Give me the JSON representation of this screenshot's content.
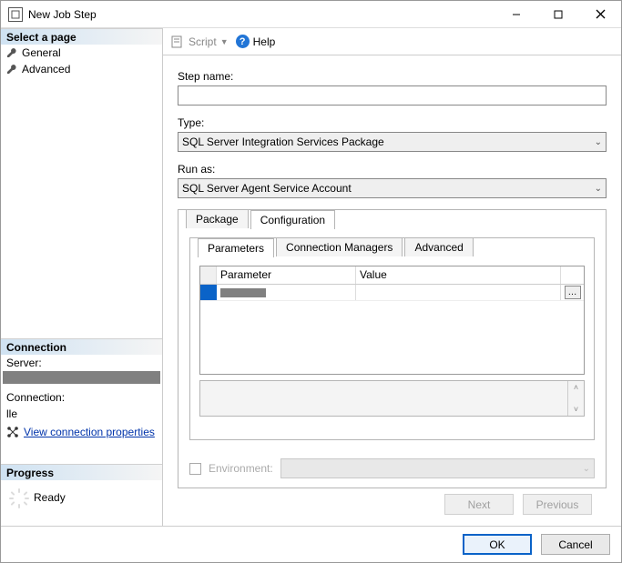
{
  "titlebar": {
    "title": "New Job Step"
  },
  "sidebar": {
    "select_page_header": "Select a page",
    "pages": [
      {
        "label": "General"
      },
      {
        "label": "Advanced"
      }
    ],
    "connection_header": "Connection",
    "server_label": "Server:",
    "connection_label": "Connection:",
    "connection_value": "lle",
    "view_conn_link": "View connection properties",
    "progress_header": "Progress",
    "progress_status": "Ready"
  },
  "toolbar": {
    "script_label": "Script",
    "help_label": "Help"
  },
  "form": {
    "step_name_label": "Step name:",
    "step_name_value": "",
    "type_label": "Type:",
    "type_value": "SQL Server Integration Services Package",
    "run_as_label": "Run as:",
    "run_as_value": "SQL Server Agent Service Account"
  },
  "outer_tabs": [
    {
      "label": "Package",
      "active": false
    },
    {
      "label": "Configuration",
      "active": true
    }
  ],
  "inner_tabs": [
    {
      "label": "Parameters",
      "active": true
    },
    {
      "label": "Connection Managers",
      "active": false
    },
    {
      "label": "Advanced",
      "active": false
    }
  ],
  "grid": {
    "headers": {
      "param": "Parameter",
      "value": "Value"
    },
    "rows": [
      {
        "param": "",
        "value": "",
        "has_button": true
      }
    ]
  },
  "environment": {
    "checkbox_checked": false,
    "label": "Environment:",
    "value": ""
  },
  "nav_buttons": {
    "next": "Next",
    "previous": "Previous"
  },
  "dialog_buttons": {
    "ok": "OK",
    "cancel": "Cancel"
  }
}
